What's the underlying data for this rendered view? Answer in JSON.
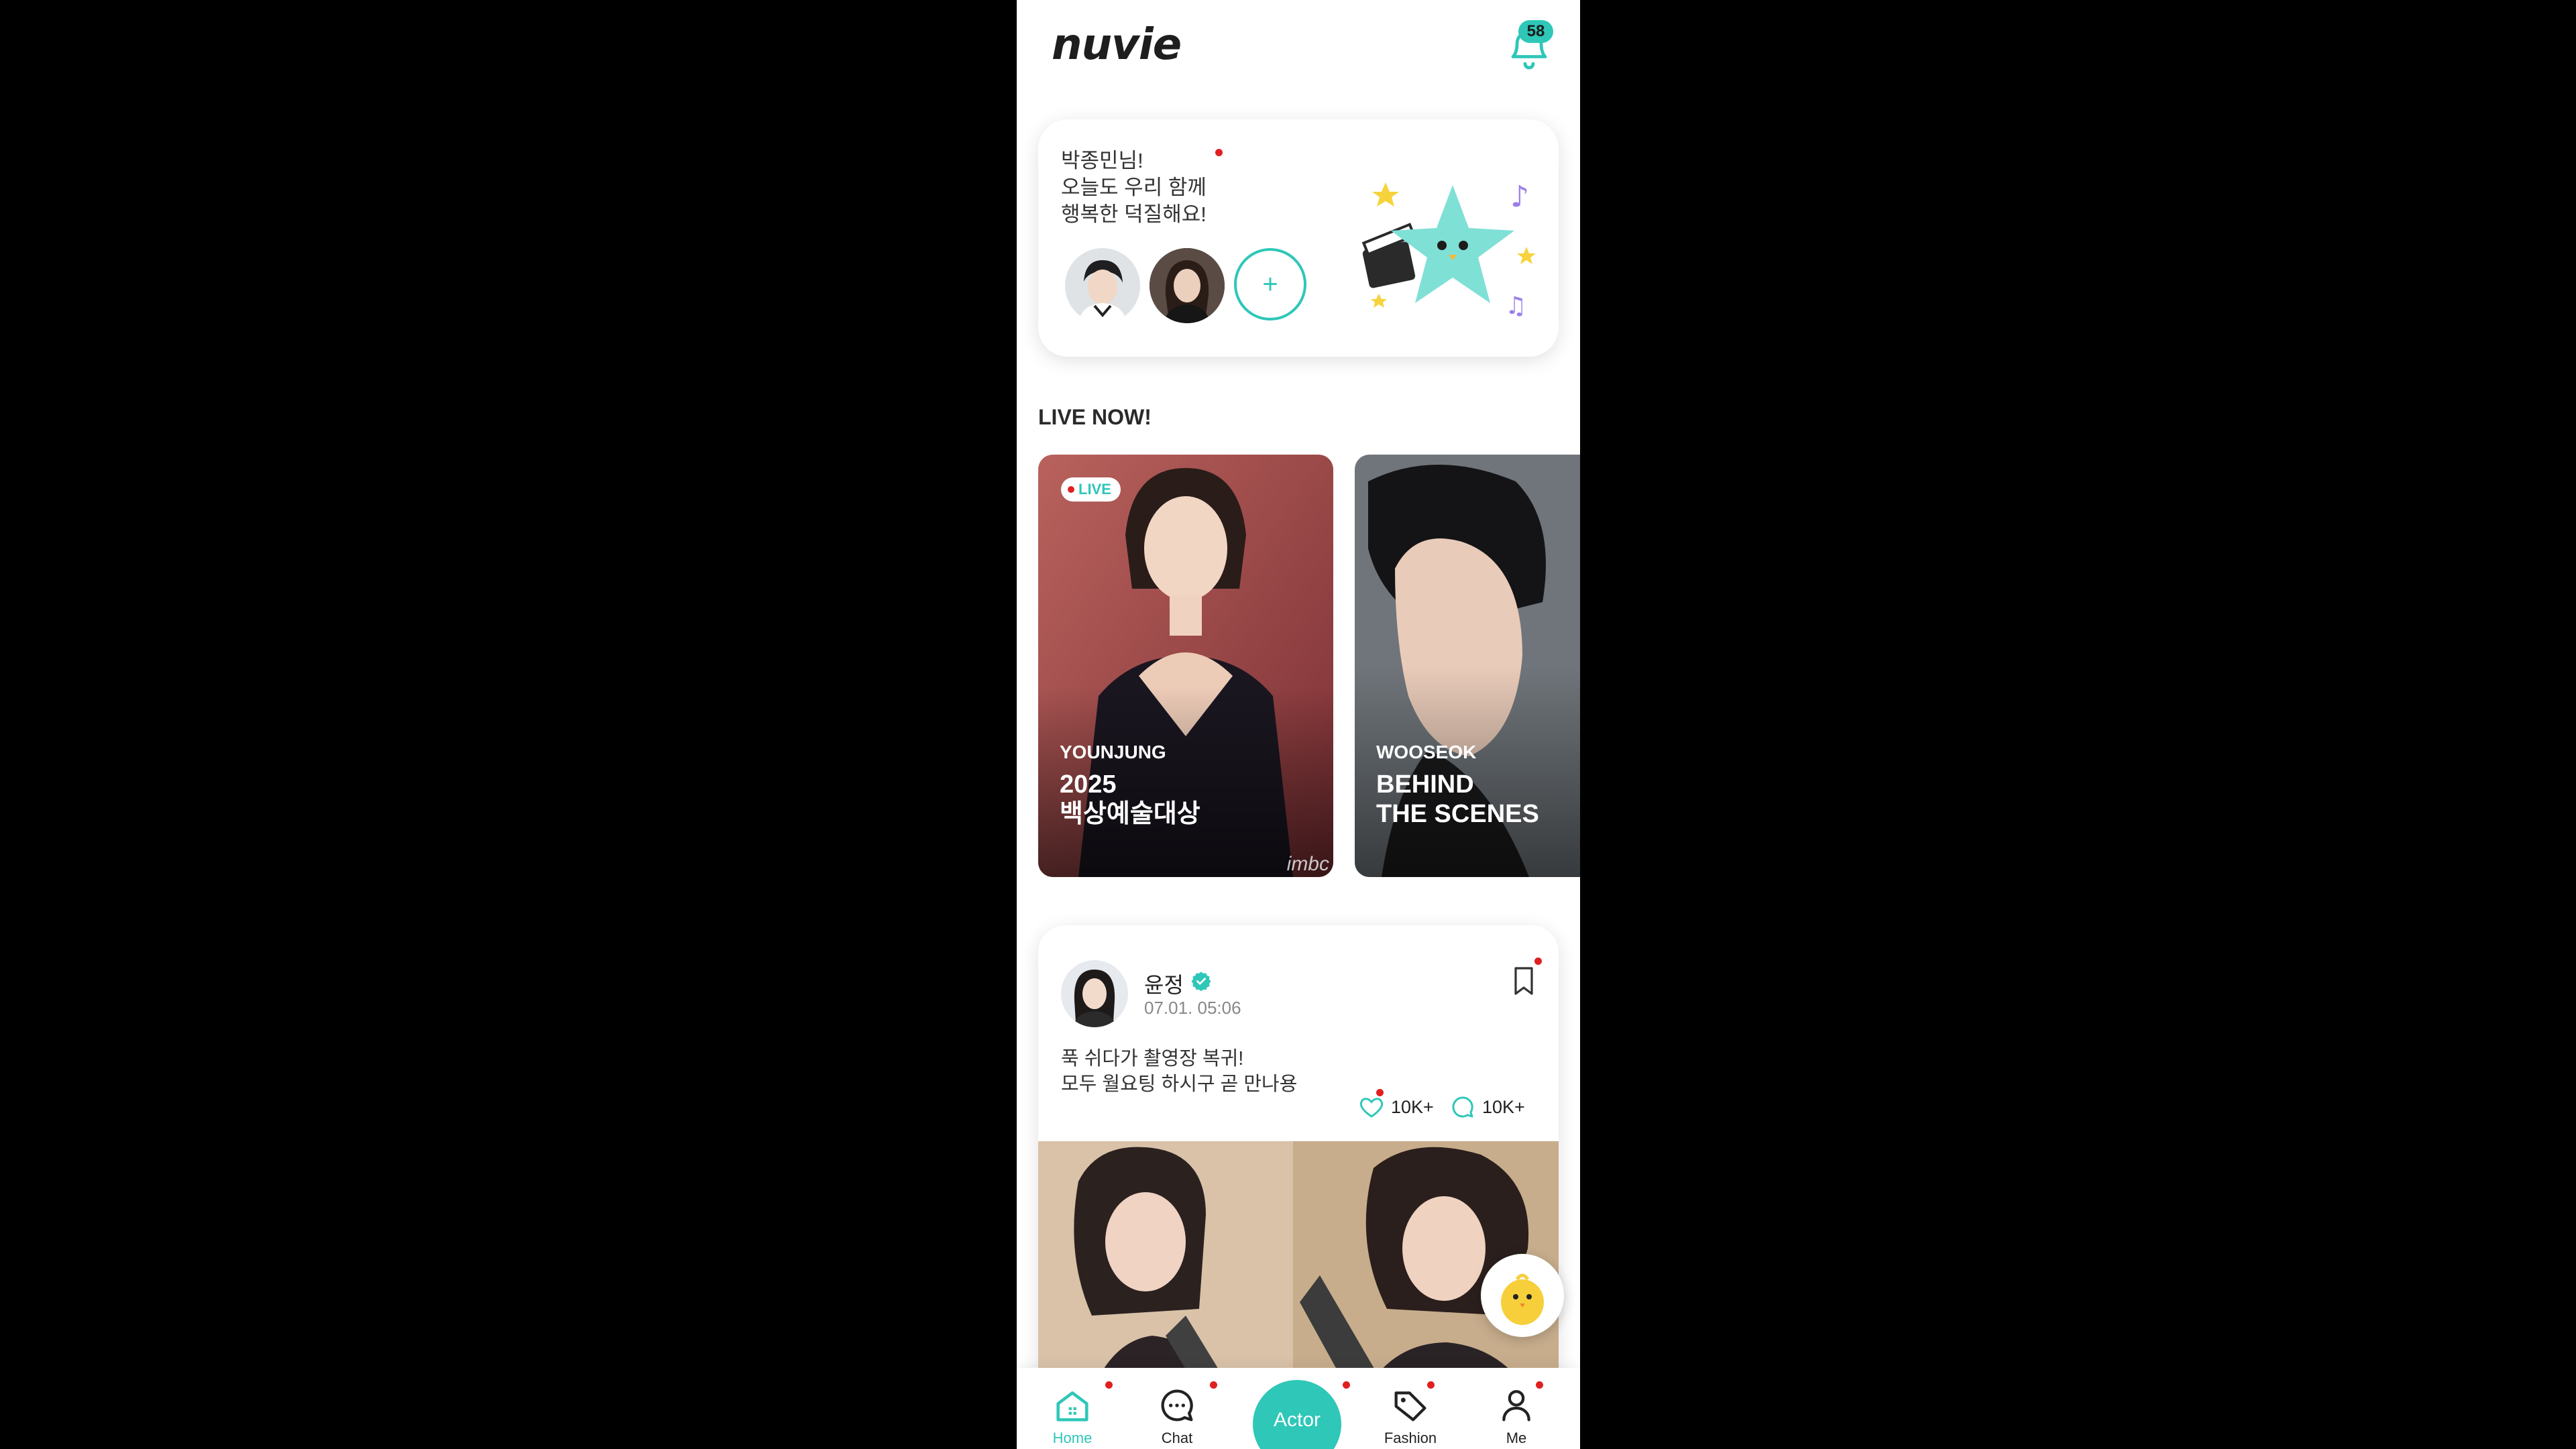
{
  "app": {
    "logo": "nuvie",
    "notification_count": "58",
    "accent_color": "#2ec7b8"
  },
  "greeting": {
    "text": "박종민님!\n오늘도 우리 함께\n행복한 덕질해요!",
    "add_label": "+"
  },
  "live": {
    "section_title": "LIVE NOW!",
    "cards": [
      {
        "badge": "LIVE",
        "name": "YOUNJUNG",
        "title": "2025\n백상예술대상",
        "watermark": "imbc"
      },
      {
        "name": "WOOSEOK",
        "title": "BEHIND\nTHE SCENES"
      }
    ]
  },
  "post": {
    "author": "윤정",
    "time": "07.01. 05:06",
    "text": "푹 쉬다가 촬영장 복귀!\n모두 월요팅 하시구 곧 만나용",
    "likes": "10K+",
    "comments": "10K+"
  },
  "nav": {
    "items": [
      {
        "label": "Home",
        "icon": "home-icon",
        "active": true
      },
      {
        "label": "Chat",
        "icon": "chat-icon"
      },
      {
        "label": "Actor",
        "icon": "actor-button"
      },
      {
        "label": "Fashion",
        "icon": "tag-icon"
      },
      {
        "label": "Me",
        "icon": "person-icon"
      }
    ]
  }
}
